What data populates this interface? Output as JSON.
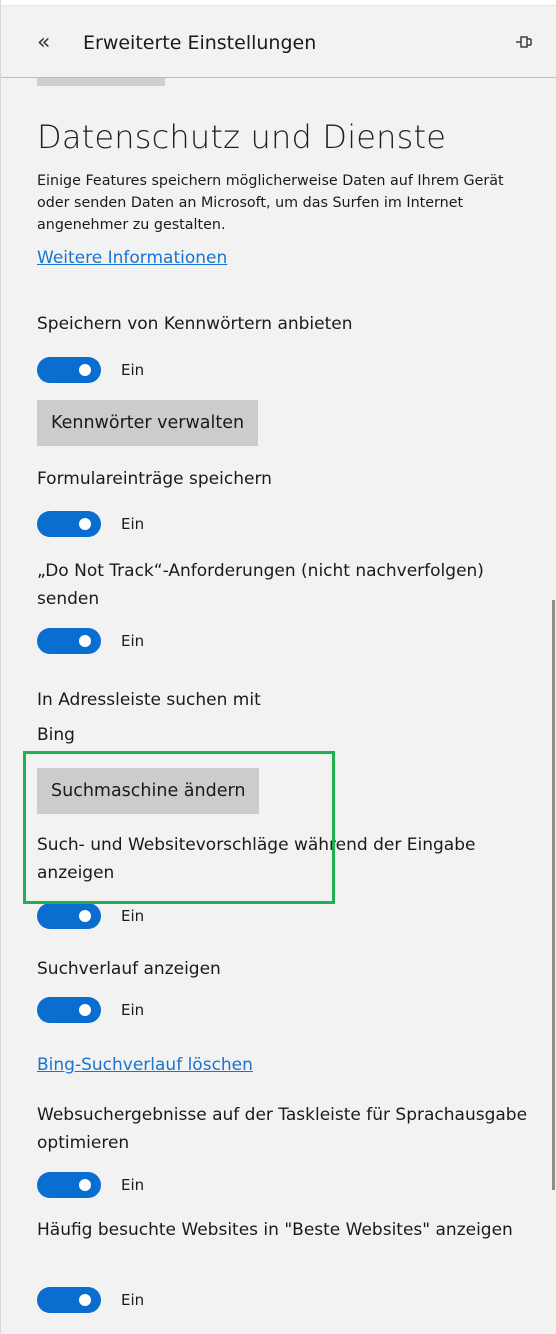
{
  "header": {
    "title": "Erweiterte Einstellungen",
    "back_icon": "double-chevron-left-icon",
    "pin_icon": "pin-icon"
  },
  "section": {
    "title": "Datenschutz und Dienste",
    "description": "Einige Features speichern möglicherweise Daten auf Ihrem Gerät oder senden Daten an Microsoft, um das Surfen im Internet angenehmer zu gestalten.",
    "more_info_link": "Weitere Informationen"
  },
  "settings": {
    "save_passwords": {
      "label": "Speichern von Kennwörtern anbieten",
      "state": "Ein",
      "button": "Kennwörter verwalten"
    },
    "form_entries": {
      "label": "Formulareinträge speichern",
      "state": "Ein"
    },
    "do_not_track": {
      "label": "„Do Not Track“-Anforderungen (nicht nachverfolgen) senden",
      "state": "Ein"
    },
    "address_bar_search": {
      "label": "In Adressleiste suchen mit",
      "value": "Bing",
      "button": "Suchmaschine ändern"
    },
    "search_suggestions": {
      "label": "Such- und Websitevorschläge während der Eingabe anzeigen",
      "state": "Ein"
    },
    "search_history": {
      "label": "Suchverlauf anzeigen",
      "state": "Ein"
    },
    "clear_bing_history_link": "Bing-Suchverlauf löschen",
    "taskbar_search": {
      "label": "Websuchergebnisse auf der Taskleiste für Sprachausgabe optimieren",
      "state": "Ein"
    },
    "top_sites": {
      "label": "Häufig besuchte Websites in \"Beste Websites\" anzeigen",
      "state": "Ein"
    }
  },
  "colors": {
    "accent": "#0a6ed1",
    "link": "#1874d0",
    "highlight": "#1fb14d",
    "panel_bg": "#f2f2f2",
    "button_bg": "#cccccc"
  }
}
